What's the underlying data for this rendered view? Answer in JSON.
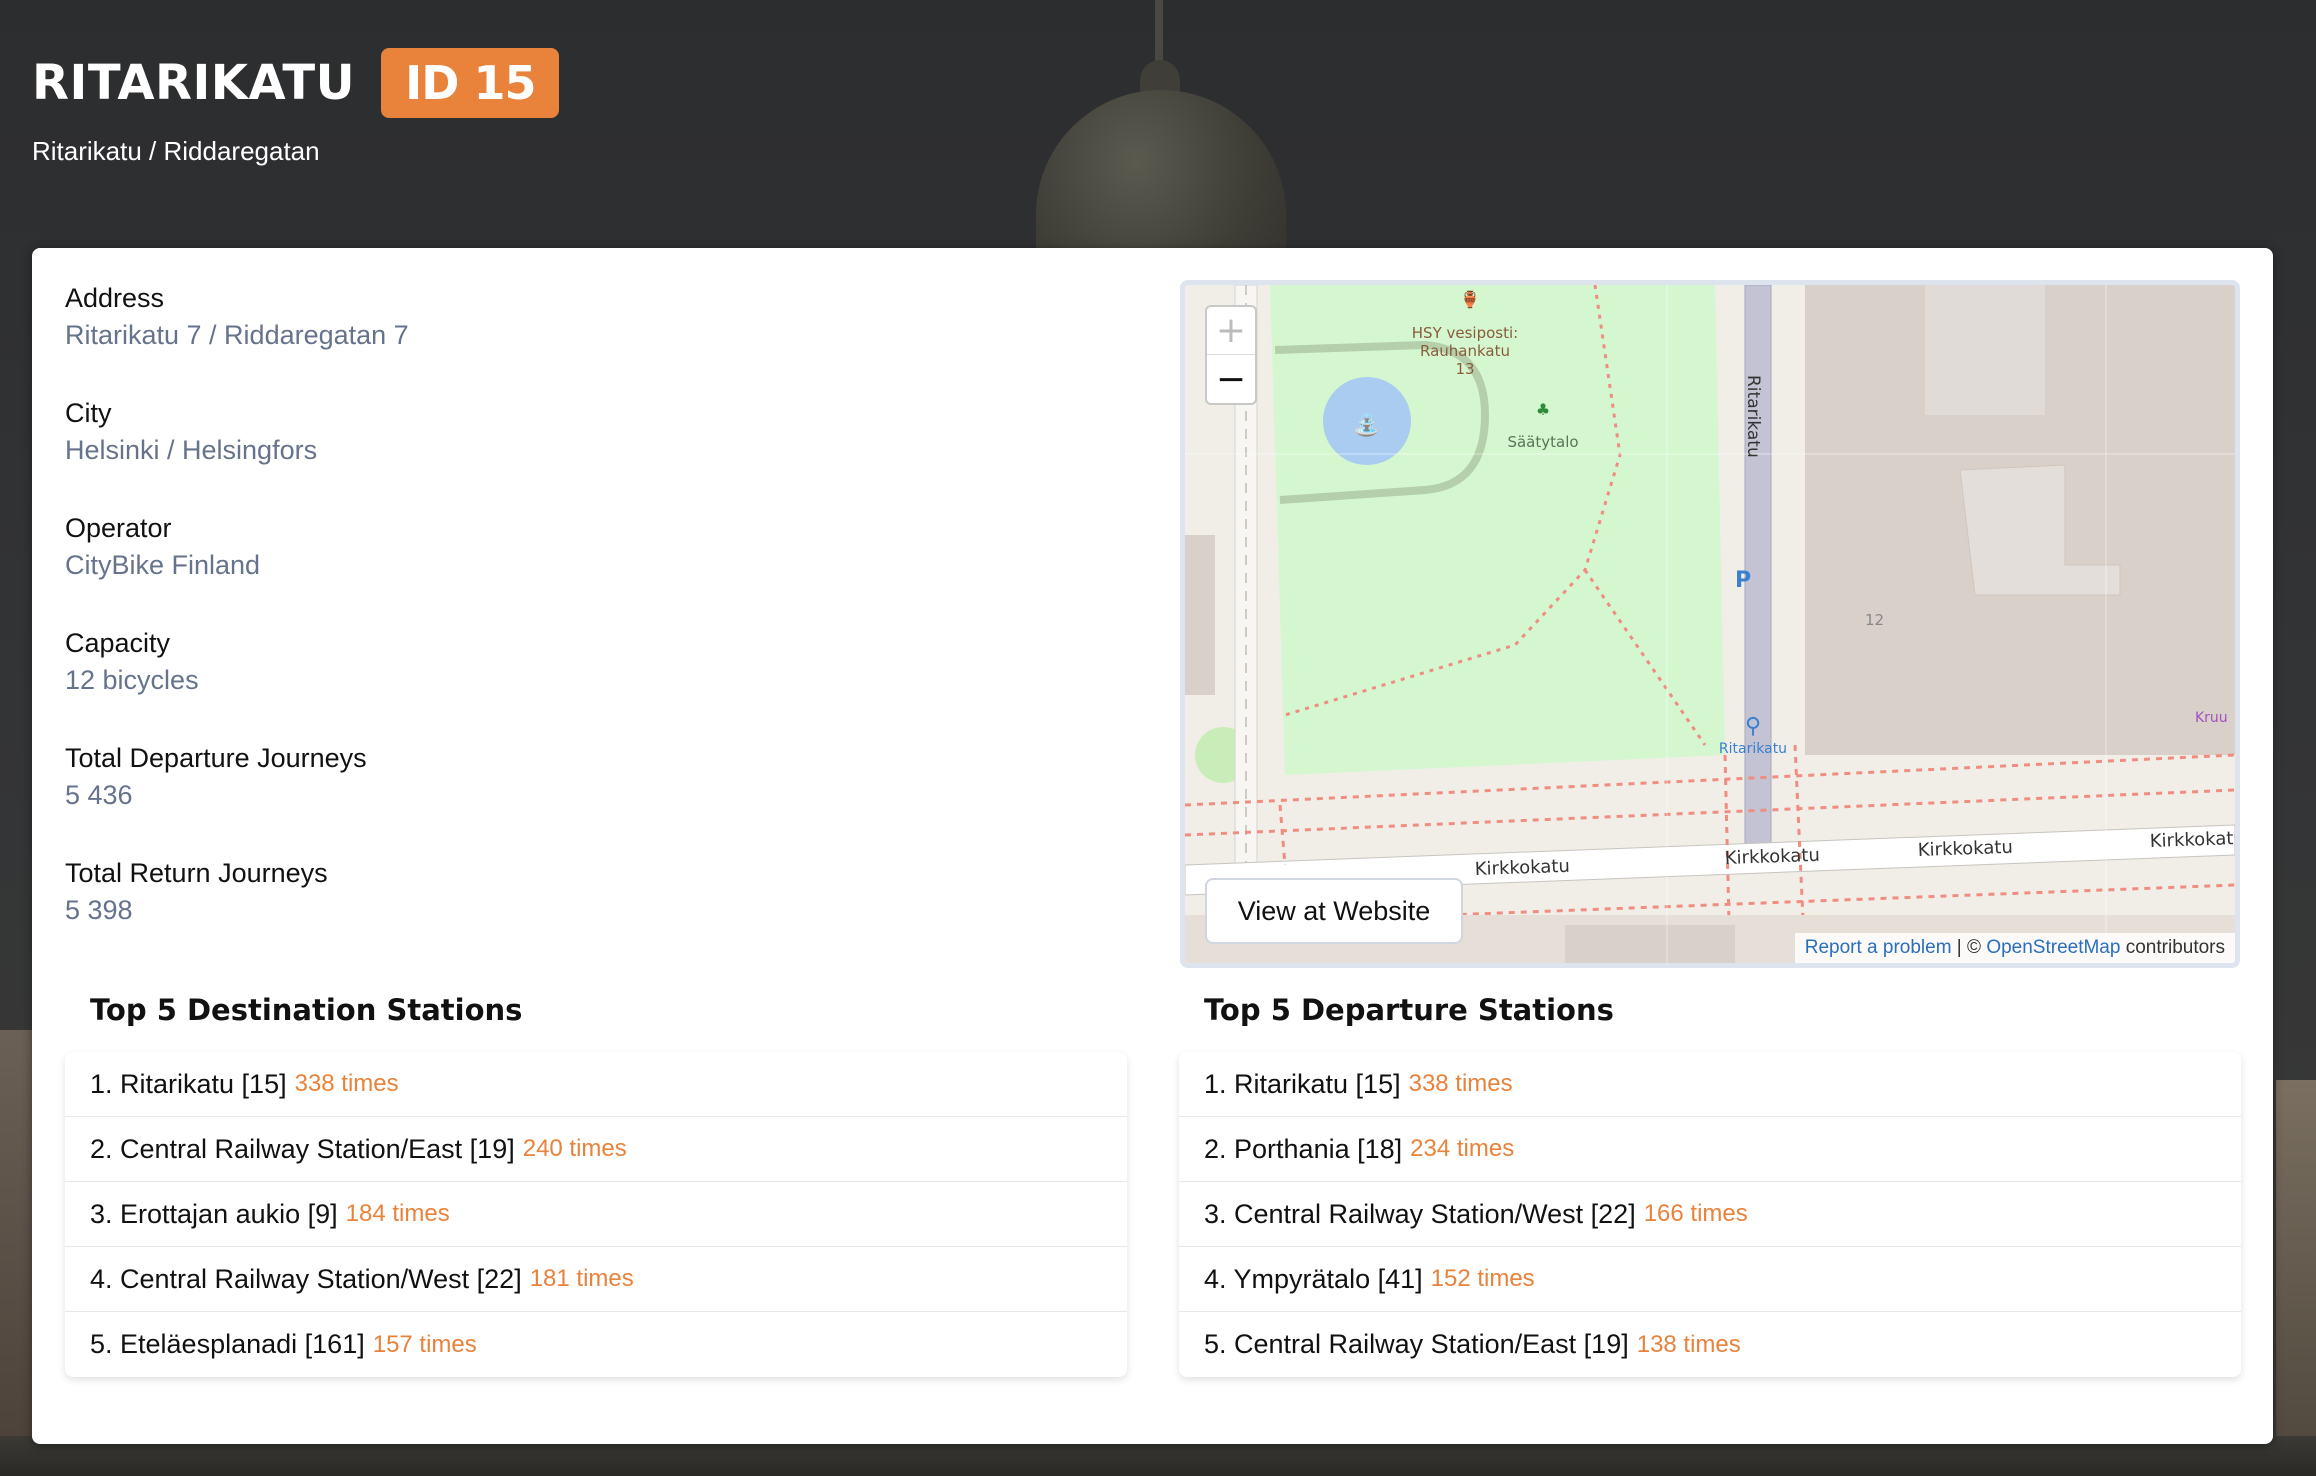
{
  "header": {
    "station_name": "RITARIKATU",
    "id_badge": "ID 15",
    "subtitle": "Ritarikatu / Riddaregatan"
  },
  "info": [
    {
      "label": "Address",
      "value": "Ritarikatu 7 / Riddaregatan 7"
    },
    {
      "label": "City",
      "value": "Helsinki / Helsingfors"
    },
    {
      "label": "Operator",
      "value": "CityBike Finland"
    },
    {
      "label": "Capacity",
      "value": "12 bicycles"
    },
    {
      "label": "Total Departure Journeys",
      "value": "5 436"
    },
    {
      "label": "Total Return Journeys",
      "value": "5 398"
    }
  ],
  "map": {
    "zoom_in": "+",
    "zoom_out": "−",
    "view_button": "View at Website",
    "attribution_link1": "Report a problem",
    "attribution_sep": " | © ",
    "attribution_link2": "OpenStreetMap",
    "attribution_suffix": " contributors",
    "labels": {
      "poi1": "HSY vesiposti:",
      "poi2": "Rauhankatu",
      "poi3": "13",
      "saatytalo": "Säätytalo",
      "street_vertical": "Ritarikatu",
      "station": "Ritarikatu",
      "kirkkokatu": "Kirkkokatu",
      "kruu": "Kruu",
      "num12": "12",
      "parking": "P"
    }
  },
  "destinations": {
    "title": "Top 5 Destination Stations",
    "items": [
      {
        "text": "1. Ritarikatu [15]",
        "times": "338 times"
      },
      {
        "text": "2. Central Railway Station/East [19]",
        "times": "240 times"
      },
      {
        "text": "3. Erottajan aukio [9]",
        "times": "184 times"
      },
      {
        "text": "4. Central Railway Station/West [22]",
        "times": "181 times"
      },
      {
        "text": "5. Eteläesplanadi [161]",
        "times": "157 times"
      }
    ]
  },
  "departures": {
    "title": "Top 5 Departure Stations",
    "items": [
      {
        "text": "1. Ritarikatu [15]",
        "times": "338 times"
      },
      {
        "text": "2. Porthania [18]",
        "times": "234 times"
      },
      {
        "text": "3. Central Railway Station/West [22]",
        "times": "166 times"
      },
      {
        "text": "4. Ympyrätalo [41]",
        "times": "152 times"
      },
      {
        "text": "5. Central Railway Station/East [19]",
        "times": "138 times"
      }
    ]
  },
  "colors": {
    "accent": "#e9823a",
    "value_text": "#66738c",
    "park_green": "#d4f7d0"
  }
}
